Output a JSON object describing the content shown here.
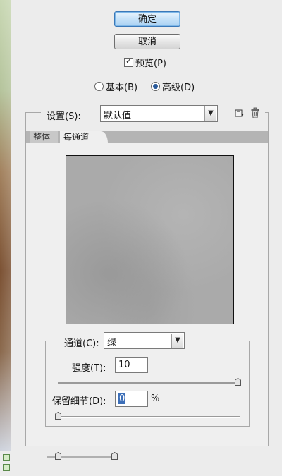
{
  "buttons": {
    "ok_label": "确定",
    "cancel_label": "取消"
  },
  "preview": {
    "label": "预览(P)",
    "checked": true
  },
  "mode": {
    "basic_label": "基本(B)",
    "advanced_label": "高级(D)",
    "selected": "advanced"
  },
  "settings": {
    "label": "设置(S):",
    "value": "默认值",
    "save_icon": "save-preset-icon",
    "delete_icon": "trash-icon"
  },
  "tabs": [
    {
      "label": "整体",
      "active": false
    },
    {
      "label": "每通道",
      "active": true
    }
  ],
  "channel": {
    "label": "通道(C):",
    "value": "绿"
  },
  "strength": {
    "label": "强度(T):",
    "value": "10",
    "slider_fraction": 1.0
  },
  "preserve_details": {
    "label": "保留细节(D):",
    "value": "0",
    "unit": "%",
    "slider_fraction": 0.0
  },
  "colors": {
    "primary_button": "#a8d1f3",
    "preview_gray": "#aaaaaa",
    "radio_dot": "#2a5a9a"
  }
}
